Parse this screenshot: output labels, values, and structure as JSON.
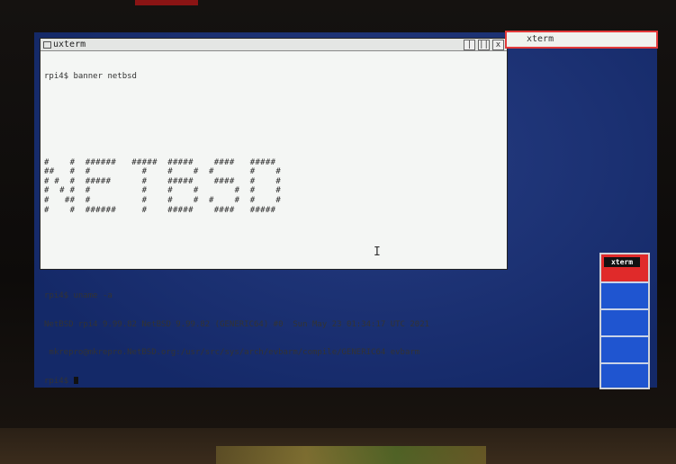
{
  "window": {
    "title": "uxterm",
    "minimize_glyph": "|",
    "maximize_glyph": "||",
    "close_glyph": "x"
  },
  "terminal": {
    "lines": [
      "rpi4$ banner netbsd",
      "rpi4$ uname -a",
      "NetBSD rpi4 9.99.82 NetBSD 9.99.82 (GENERIC64) #0  Sun May 23 01:34:17 UTC 2021",
      " mkrepro@mkrepro.NetBSD.org:/usr/src/sys/arch/evbarm/compile/GENERIC64 evbarm",
      "rpi4$ "
    ],
    "banner_rows": [
      "#    #  ######   #####  #####    ####   #####",
      "##   #  #          #    #    #  #       #    #",
      "# #  #  #####      #    #####    ####   #    #",
      "#  # #  #          #    #    #       #  #    #",
      "#   ##  #          #    #    #  #    #  #    #",
      "#    #  ######     #    #####    ####   #####"
    ]
  },
  "second_window": {
    "title": "xterm"
  },
  "pager": {
    "active_label": "xterm",
    "desktops": 5
  }
}
